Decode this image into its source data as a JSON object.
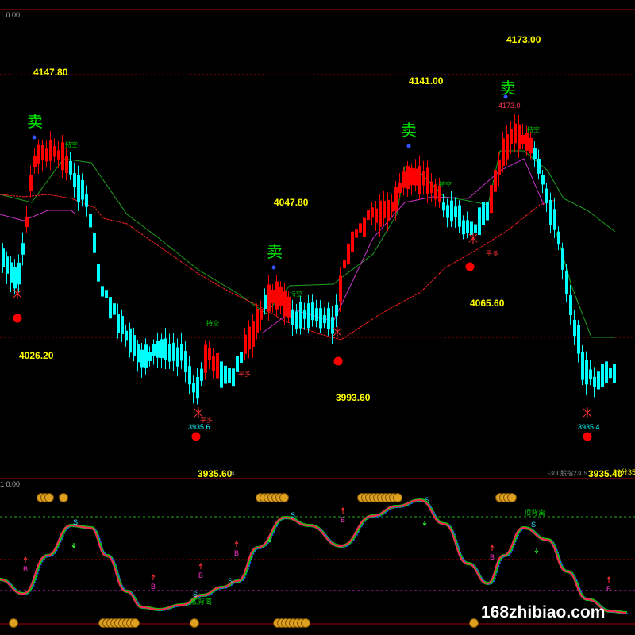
{
  "chart_data": {
    "type": "candlestick",
    "main_panel": {
      "header_value": "1 0.00",
      "price_levels": [
        {
          "label": "4147.80"
        },
        {
          "label": "4141.00"
        },
        {
          "label": "4173.00"
        },
        {
          "label": "4047.80"
        },
        {
          "label": "4065.60"
        },
        {
          "label": "4026.20"
        },
        {
          "label": "3993.60"
        },
        {
          "label": "3935.60"
        },
        {
          "label": "3935.40"
        }
      ],
      "small_labels": [
        "3935.6",
        "4173.0",
        "3935.4"
      ],
      "sell_signal": "卖",
      "hold_label": "持空",
      "exit_label": "平多",
      "footer_labels": {
        "contract": "-300股指2305",
        "time": "29分35秒",
        "left_partial": "...04"
      },
      "horizontal_levels": [
        4147.8,
        4026.2
      ],
      "series": [
        {
          "name": "",
          "color": "#00ffff"
        },
        {
          "name": "",
          "color": "#ff0000"
        }
      ]
    },
    "sub_panel": {
      "header_value": "1 0.00",
      "labels": {
        "buy": "B",
        "sell": "S",
        "divergence_top": "顶背离",
        "divergence_bottom": "底背离"
      },
      "coin_symbol": "●"
    }
  },
  "watermark": "168zhibiao.com"
}
